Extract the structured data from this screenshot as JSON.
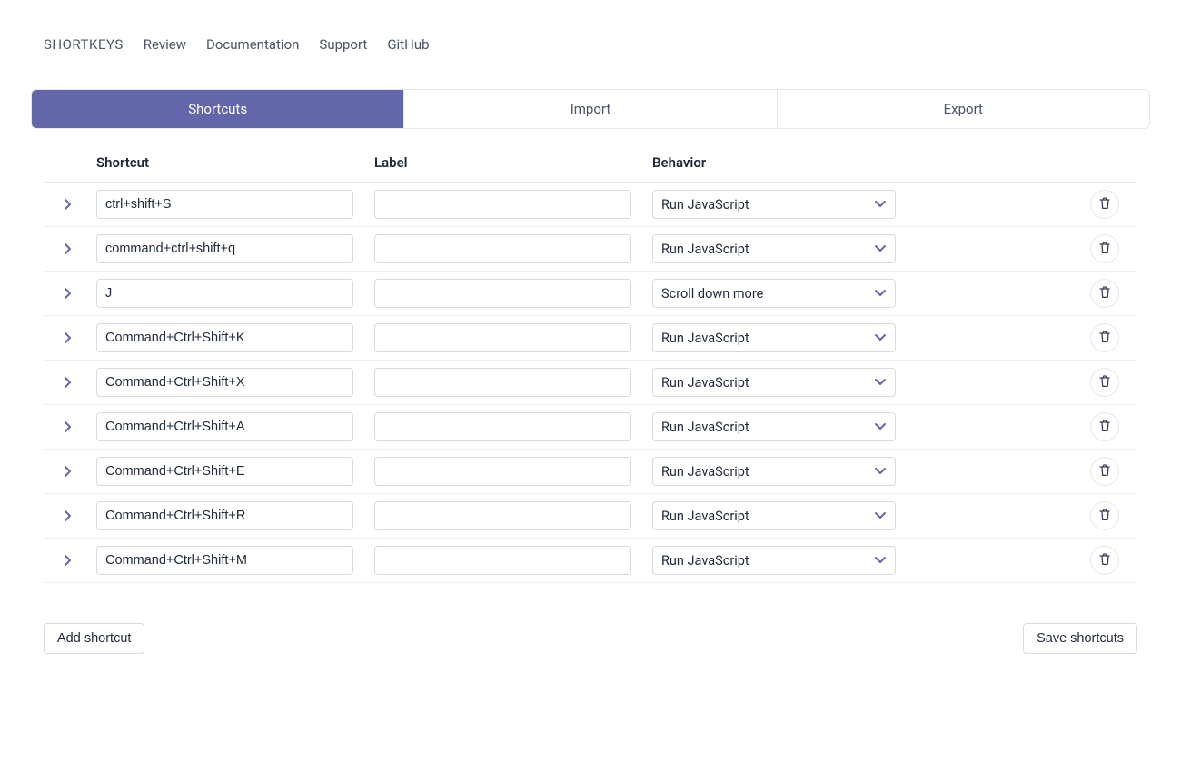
{
  "nav": {
    "brand": "SHORTKEYS",
    "links": [
      "Review",
      "Documentation",
      "Support",
      "GitHub"
    ]
  },
  "tabs": [
    {
      "label": "Shortcuts",
      "active": true
    },
    {
      "label": "Import",
      "active": false
    },
    {
      "label": "Export",
      "active": false
    }
  ],
  "columns": {
    "shortcut": "Shortcut",
    "label": "Label",
    "behavior": "Behavior"
  },
  "rows": [
    {
      "shortcut": "ctrl+shift+S",
      "label": "",
      "behavior": "Run JavaScript"
    },
    {
      "shortcut": "command+ctrl+shift+q",
      "label": "",
      "behavior": "Run JavaScript"
    },
    {
      "shortcut": "J",
      "label": "",
      "behavior": "Scroll down more"
    },
    {
      "shortcut": "Command+Ctrl+Shift+K",
      "label": "",
      "behavior": "Run JavaScript"
    },
    {
      "shortcut": "Command+Ctrl+Shift+X",
      "label": "",
      "behavior": "Run JavaScript"
    },
    {
      "shortcut": "Command+Ctrl+Shift+A",
      "label": "",
      "behavior": "Run JavaScript"
    },
    {
      "shortcut": "Command+Ctrl+Shift+E",
      "label": "",
      "behavior": "Run JavaScript"
    },
    {
      "shortcut": "Command+Ctrl+Shift+R",
      "label": "",
      "behavior": "Run JavaScript"
    },
    {
      "shortcut": "Command+Ctrl+Shift+M",
      "label": "",
      "behavior": "Run JavaScript"
    }
  ],
  "buttons": {
    "add": "Add shortcut",
    "save": "Save shortcuts"
  }
}
